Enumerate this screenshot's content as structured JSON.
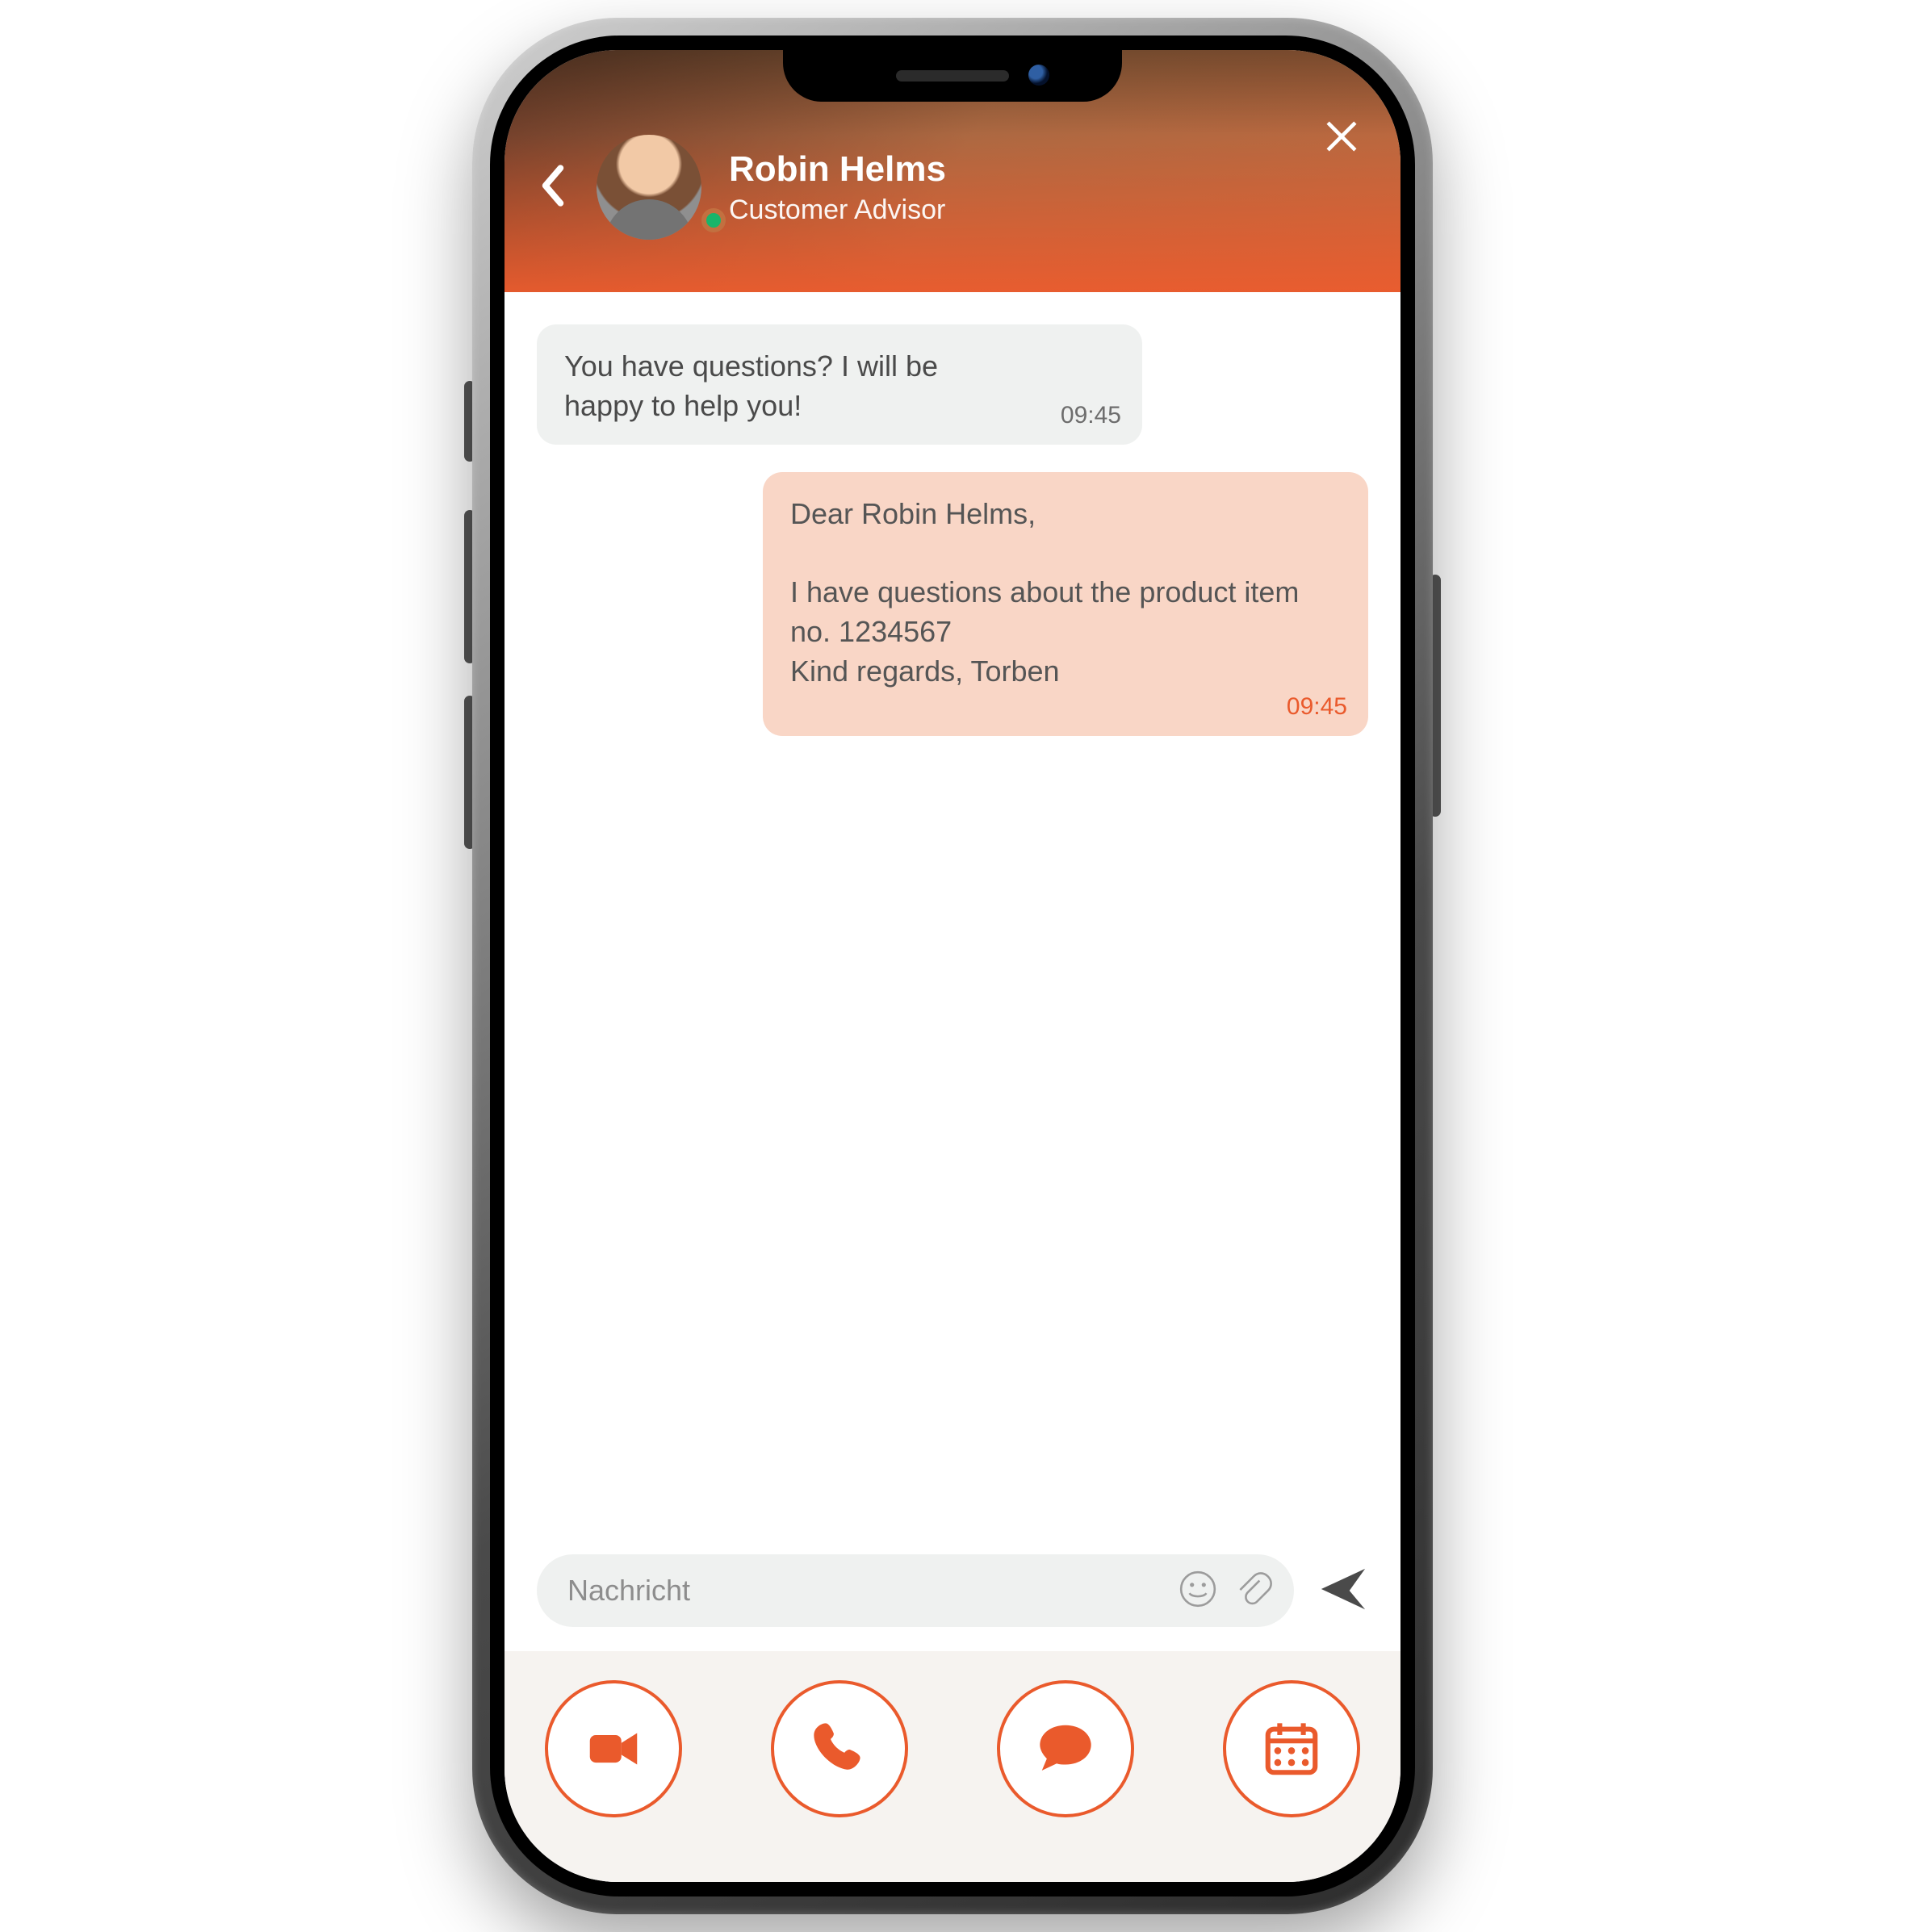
{
  "colors": {
    "accent": "#ea5a2c",
    "presence": "#18b56a"
  },
  "header": {
    "name": "Robin Helms",
    "role": "Customer Advisor",
    "presence": "online"
  },
  "messages": [
    {
      "direction": "in",
      "text": "You have questions? I will be happy to help you!",
      "time": "09:45"
    },
    {
      "direction": "out",
      "text": "Dear Robin Helms,\n\nI have questions about the product item no. 1234567\nKind regards, Torben",
      "time": "09:45"
    }
  ],
  "composer": {
    "placeholder": "Nachricht",
    "value": ""
  },
  "toolbar": {
    "items": [
      {
        "id": "video",
        "icon": "video-icon"
      },
      {
        "id": "call",
        "icon": "phone-icon"
      },
      {
        "id": "chat",
        "icon": "chat-icon"
      },
      {
        "id": "calendar",
        "icon": "calendar-icon"
      }
    ]
  }
}
